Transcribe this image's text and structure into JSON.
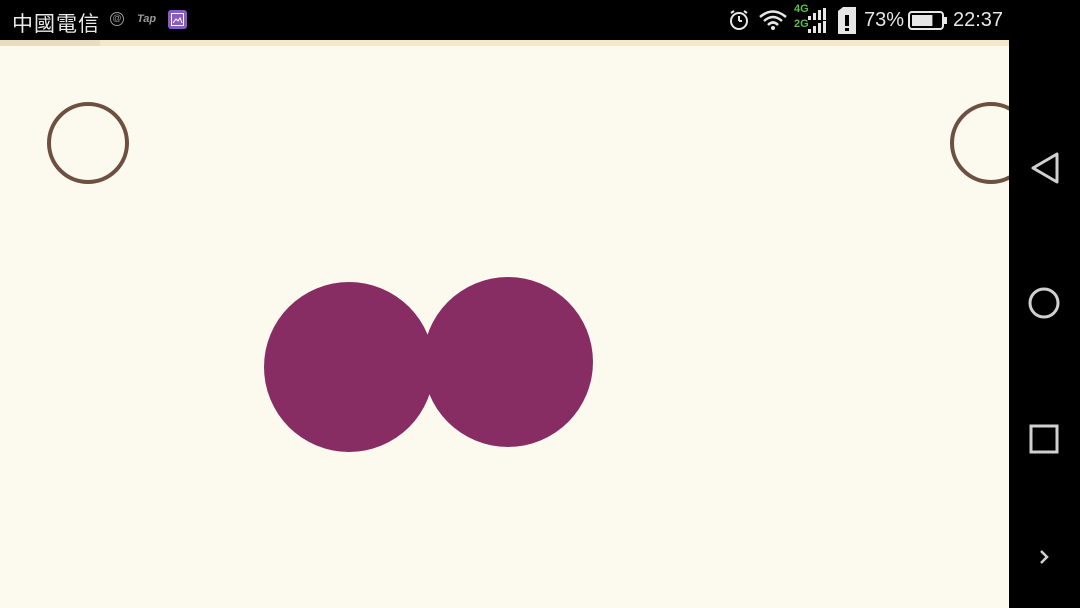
{
  "status_bar": {
    "carrier": "中國電信",
    "notification_icons": [
      "at-sign-icon",
      "tap-icon",
      "gallery-icon"
    ],
    "network_types": [
      "4G",
      "2G"
    ],
    "battery_percent": "73%",
    "battery_level": 0.73,
    "time": "22:37"
  },
  "nav_bar": {
    "buttons": [
      "back-icon",
      "home-icon",
      "recent-apps-icon",
      "chevron-right-icon"
    ]
  },
  "app": {
    "background": "#fcf9ef",
    "ring_color": "#6e5040",
    "blob_color": "#872d63",
    "tap_notif_label": "Tap"
  }
}
